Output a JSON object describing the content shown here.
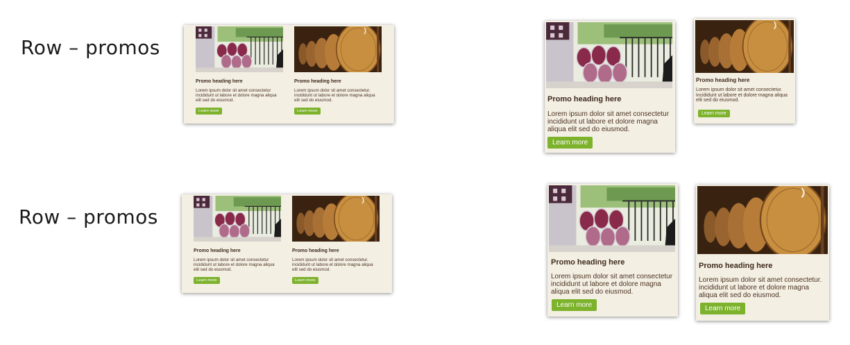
{
  "rows": [
    {
      "label": "Row – promos"
    },
    {
      "label": "Row – promos"
    }
  ],
  "promo": {
    "heading": "Promo heading here",
    "body_glasses": "Lorem ipsum dolor sit amet consectetur incididunt ut labore et dolore magna aliqua elit sed do eiusmod.",
    "body_barrels": "Lorem ipsum dolor sit amet consectetur. incididunt ut labore et dolore magna aliqua elit sed do eiusmod.",
    "button": "Learn more",
    "images": {
      "left": "wine-glasses-image",
      "right": "wine-barrels-image"
    }
  },
  "colors": {
    "panel_bg": "#f4efe3",
    "button": "#7cb22c",
    "text": "#4a3222"
  }
}
